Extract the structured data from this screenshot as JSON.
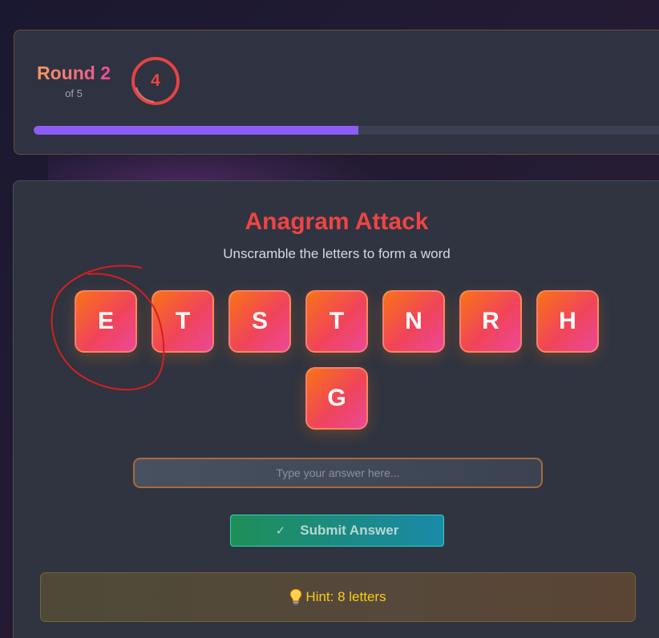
{
  "round": {
    "label": "Round 2",
    "of_label": "of 5",
    "timer_value": "4",
    "progress_fraction": 0.5
  },
  "game": {
    "title": "Anagram Attack",
    "subtitle": "Unscramble the letters to form a word",
    "tiles": [
      "E",
      "T",
      "S",
      "T",
      "N",
      "R",
      "H",
      "G"
    ],
    "input_placeholder": "Type your answer here...",
    "submit_label": "Submit Answer",
    "submit_icon": "checkmark-icon",
    "hint_text": "Hint: 8 letters",
    "hint_icon": "lightbulb-icon"
  },
  "colors": {
    "accent_red": "#ef4444",
    "progress_purple": "#8b5cf6",
    "hint_yellow": "#facc15"
  }
}
